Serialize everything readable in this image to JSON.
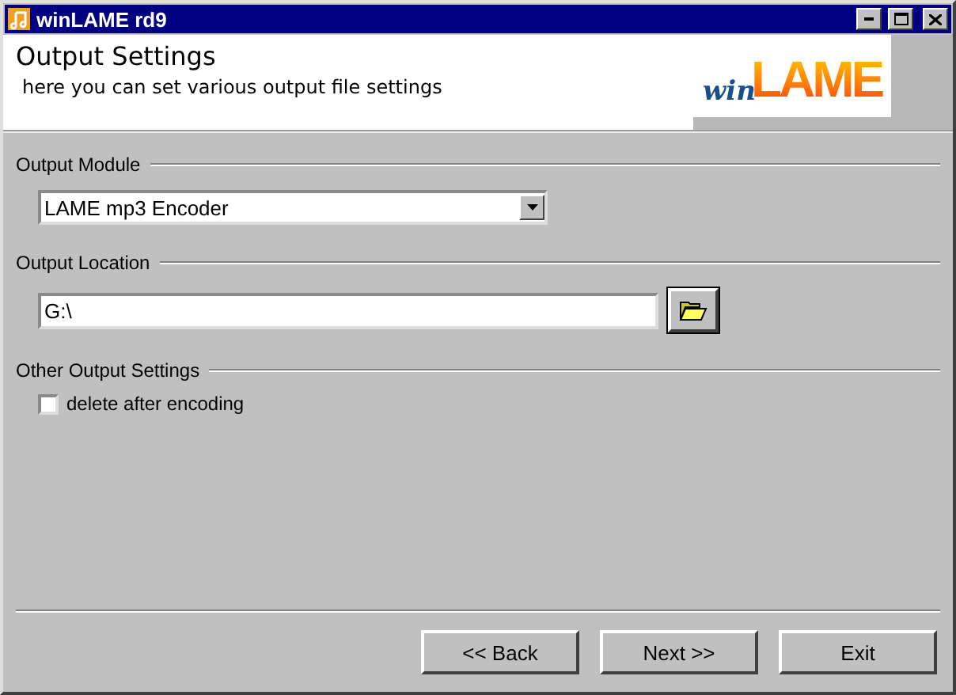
{
  "window": {
    "title": "winLAME rd9"
  },
  "header": {
    "title": "Output Settings",
    "subtitle": "here you can set various output file settings",
    "logo": {
      "prefix": "win",
      "main": "LAME"
    }
  },
  "groups": [
    {
      "kind": "combo",
      "label": "Output Module",
      "value": "LAME mp3 Encoder"
    },
    {
      "kind": "path",
      "label": "Output Location",
      "value": "G:\\"
    },
    {
      "kind": "checks",
      "label": "Other Output Settings",
      "options": [
        {
          "label": "delete after encoding",
          "checked": false
        }
      ]
    }
  ],
  "buttons": [
    {
      "label": "<< Back"
    },
    {
      "label": "Next >>"
    },
    {
      "label": "Exit"
    }
  ]
}
